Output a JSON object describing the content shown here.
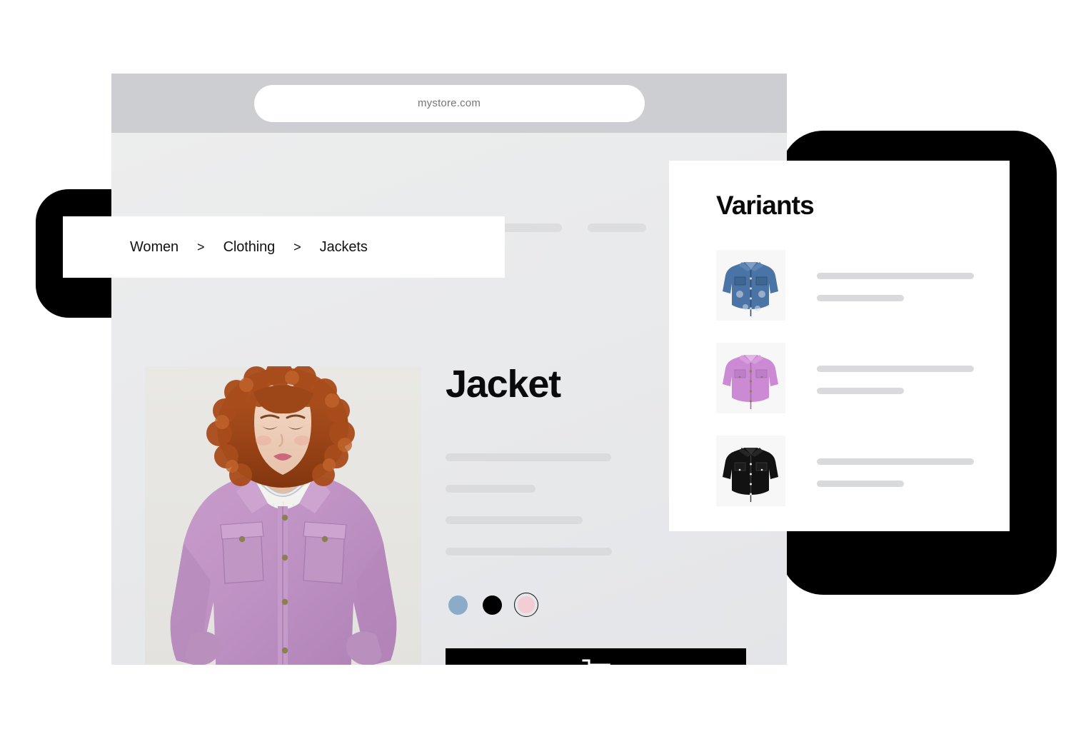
{
  "browser": {
    "url": "mystore.com",
    "nav_placeholders": [
      "",
      ""
    ]
  },
  "breadcrumb": {
    "separator": ">",
    "items": [
      {
        "label": "Women"
      },
      {
        "label": "Clothing"
      },
      {
        "label": "Jackets"
      }
    ]
  },
  "product": {
    "title": "Jacket",
    "image_alt": "woman-in-lilac-jacket-photo",
    "description_placeholders": [
      "",
      "",
      "",
      ""
    ],
    "colors": [
      {
        "name": "blue",
        "hex": "#8babc9",
        "selected": false
      },
      {
        "name": "black",
        "hex": "#000000",
        "selected": false
      },
      {
        "name": "pink",
        "hex": "#f3cdd5",
        "selected": true
      }
    ],
    "add_to_cart": {
      "icon": "shopping-cart-icon",
      "label": "",
      "background": "#000000"
    }
  },
  "variants_panel": {
    "title": "Variants",
    "items": [
      {
        "thumbnail_alt": "denim-blue-jacket-thumbnail",
        "color_hex": "#45699a",
        "line_long": "",
        "line_short": ""
      },
      {
        "thumbnail_alt": "lilac-pink-jacket-thumbnail",
        "color_hex": "#c98bd2",
        "line_long": "",
        "line_short": ""
      },
      {
        "thumbnail_alt": "black-jacket-thumbnail",
        "color_hex": "#121212",
        "line_long": "",
        "line_short": ""
      }
    ]
  },
  "decor": {
    "accent_color": "#000000",
    "chrome_color": "#cdced2",
    "page_background": "#e9eaec"
  }
}
